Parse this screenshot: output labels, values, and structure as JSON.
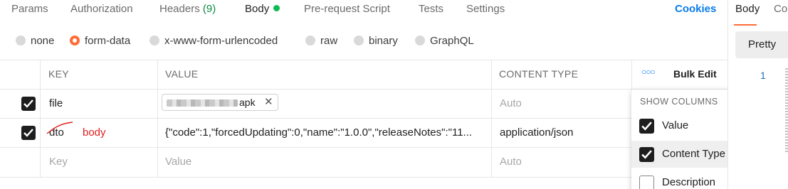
{
  "tabs": [
    {
      "label": "Params"
    },
    {
      "label": "Authorization"
    },
    {
      "label": "Headers",
      "count": "(9)"
    },
    {
      "label": "Body"
    },
    {
      "label": "Pre-request Script"
    },
    {
      "label": "Tests"
    },
    {
      "label": "Settings"
    }
  ],
  "cookies_label": "Cookies",
  "body_types": [
    "none",
    "form-data",
    "x-www-form-urlencoded",
    "raw",
    "binary",
    "GraphQL"
  ],
  "selected_body_type": "form-data",
  "table": {
    "headers": {
      "key": "KEY",
      "value": "VALUE",
      "content_type": "CONTENT TYPE",
      "bulk_edit": "Bulk Edit"
    },
    "rows": [
      {
        "checked": true,
        "key": "file",
        "file_suffix": "apk",
        "content_type_placeholder": "Auto"
      },
      {
        "checked": true,
        "key": "dto",
        "value": "{\"code\":1,\"forcedUpdating\":0,\"name\":\"1.0.0\",\"releaseNotes\":\"11...",
        "content_type": "application/json"
      }
    ],
    "new_row": {
      "key_placeholder": "Key",
      "value_placeholder": "Value",
      "content_type_placeholder": "Auto"
    }
  },
  "annotation": "body",
  "show_columns_menu": {
    "title": "SHOW COLUMNS",
    "items": [
      {
        "label": "Value",
        "checked": true
      },
      {
        "label": "Content Type",
        "checked": true
      },
      {
        "label": "Description",
        "checked": false
      }
    ]
  },
  "response_pane": {
    "tabs": [
      "Body",
      "Co"
    ],
    "pretty_label": "Pretty",
    "line_number": "1"
  },
  "colors": {
    "accent": "#ff6c37",
    "link": "#097bed",
    "active_dot": "#0cbb52",
    "annotation": "#e02020"
  }
}
